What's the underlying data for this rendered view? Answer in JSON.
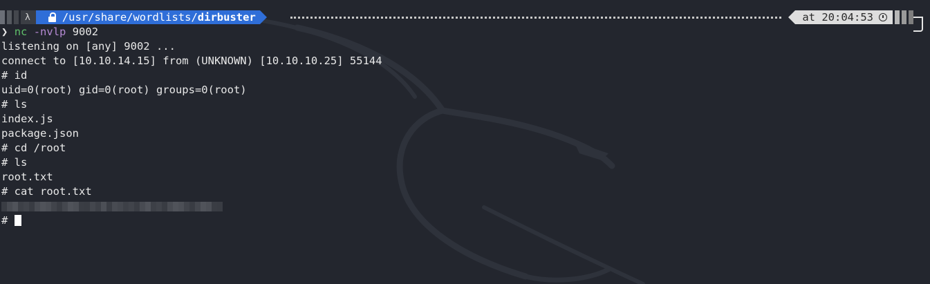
{
  "prompt": {
    "os_glyph": "",
    "os_icon": "kali-linux-icon",
    "lock_icon": "lock-icon",
    "path_prefix": "/usr/share/wordlists/",
    "path_current": "dirbuster",
    "time_label": "at 20:04:53",
    "clock_icon": "clock-icon",
    "colors": {
      "path_bg": "#2f6ed8",
      "time_bg": "#dedede"
    }
  },
  "terminal": {
    "prompt_char": "❯",
    "command_name": "nc",
    "command_flags": "-nvlp",
    "command_arg": "9002",
    "lines": [
      "listening on [any] 9002 ...",
      "connect to [10.10.14.15] from (UNKNOWN) [10.10.10.25] 55144",
      "# id",
      "uid=0(root) gid=0(root) groups=0(root)",
      "# ls",
      "index.js",
      "package.json",
      "# cd /root",
      "# ls",
      "root.txt",
      "# cat root.txt"
    ],
    "redacted_line": "[redacted root flag]",
    "final_prompt": "#"
  }
}
